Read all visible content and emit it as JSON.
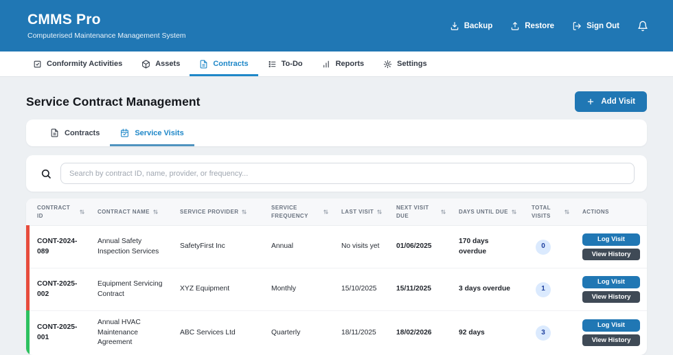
{
  "header": {
    "title": "CMMS Pro",
    "subtitle": "Computerised Maintenance Management System",
    "actions": [
      {
        "label": "Backup",
        "icon": "download-icon"
      },
      {
        "label": "Restore",
        "icon": "upload-icon"
      },
      {
        "label": "Sign Out",
        "icon": "sign-out-icon"
      }
    ],
    "bell": "bell-icon"
  },
  "nav": {
    "tabs": [
      {
        "label": "Conformity Activities",
        "icon": "clipboard-check-icon",
        "active": false
      },
      {
        "label": "Assets",
        "icon": "package-icon",
        "active": false
      },
      {
        "label": "Contracts",
        "icon": "document-icon",
        "active": true
      },
      {
        "label": "To-Do",
        "icon": "todo-list-icon",
        "active": false
      },
      {
        "label": "Reports",
        "icon": "bar-chart-icon",
        "active": false
      },
      {
        "label": "Settings",
        "icon": "gear-icon",
        "active": false
      }
    ]
  },
  "page": {
    "title": "Service Contract Management",
    "add_visit_label": "Add Visit"
  },
  "subtabs": [
    {
      "label": "Contracts",
      "icon": "document-icon",
      "active": false
    },
    {
      "label": "Service Visits",
      "icon": "calendar-check-icon",
      "active": true
    }
  ],
  "search": {
    "placeholder": "Search by contract ID, name, provider, or frequency..."
  },
  "table": {
    "columns": [
      {
        "label": "Contract ID",
        "sortable": true
      },
      {
        "label": "Contract Name",
        "sortable": true
      },
      {
        "label": "Service Provider",
        "sortable": true
      },
      {
        "label": "Service Frequency",
        "sortable": true
      },
      {
        "label": "Last Visit",
        "sortable": true
      },
      {
        "label": "Next Visit Due",
        "sortable": true
      },
      {
        "label": "Days Until Due",
        "sortable": true
      },
      {
        "label": "Total Visits",
        "sortable": true
      },
      {
        "label": "Actions",
        "sortable": false
      }
    ],
    "log_visit_label": "Log Visit",
    "view_history_label": "View History",
    "rows": [
      {
        "status_color": "#e74c3c",
        "contract_id": "CONT-2024-089",
        "contract_name": "Annual Safety Inspection Services",
        "service_provider": "SafetyFirst Inc",
        "service_frequency": "Annual",
        "last_visit": "No visits yet",
        "next_visit_due": "01/06/2025",
        "days_until_due": "170 days overdue",
        "total_visits": "0"
      },
      {
        "status_color": "#e74c3c",
        "contract_id": "CONT-2025-002",
        "contract_name": "Equipment Servicing Contract",
        "service_provider": "XYZ Equipment",
        "service_frequency": "Monthly",
        "last_visit": "15/10/2025",
        "next_visit_due": "15/11/2025",
        "days_until_due": "3 days overdue",
        "total_visits": "1"
      },
      {
        "status_color": "#2dc15f",
        "contract_id": "CONT-2025-001",
        "contract_name": "Annual HVAC Maintenance Agreement",
        "service_provider": "ABC Services Ltd",
        "service_frequency": "Quarterly",
        "last_visit": "18/11/2025",
        "next_visit_due": "18/02/2026",
        "days_until_due": "92 days",
        "total_visits": "3"
      }
    ]
  },
  "colors": {
    "header_bg": "#2077b4",
    "accent": "#1e87c8",
    "primary_button": "#2077b4",
    "dark_button": "#3f4a56",
    "overdue_stripe": "#e74c3c",
    "ok_stripe": "#2dc15f",
    "badge_bg": "#dbeafe",
    "badge_text": "#1d3f9e",
    "page_bg": "#edf0f3"
  }
}
